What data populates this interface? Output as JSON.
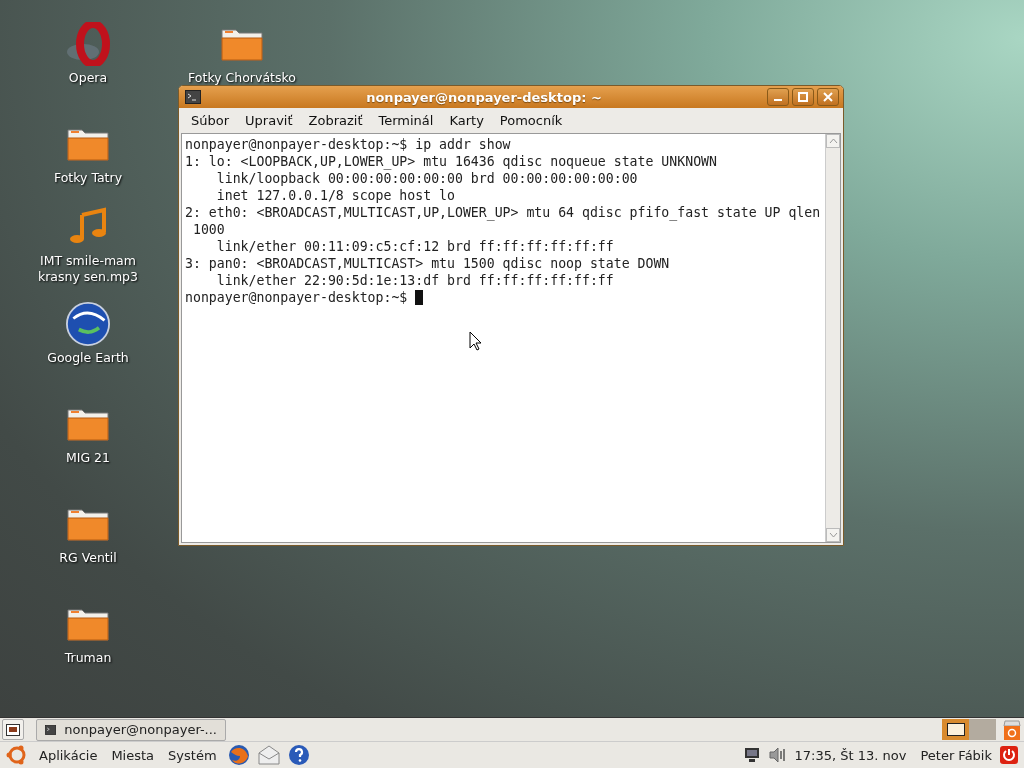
{
  "desktop_icons": [
    {
      "label": "Opera",
      "kind": "opera"
    },
    {
      "label": "Fotky Chorvátsko",
      "kind": "folder"
    },
    {
      "label": "Fotky Tatry",
      "kind": "folder"
    },
    {
      "label": "IMT smile-mam krasny sen.mp3",
      "kind": "music"
    },
    {
      "label": "Google Earth",
      "kind": "earth"
    },
    {
      "label": "MIG 21",
      "kind": "folder"
    },
    {
      "label": "RG Ventil",
      "kind": "folder"
    },
    {
      "label": "Truman",
      "kind": "folder"
    }
  ],
  "window": {
    "title": "nonpayer@nonpayer-desktop: ~",
    "menu": [
      "Súbor",
      "Upraviť",
      "Zobraziť",
      "Terminál",
      "Karty",
      "Pomocník"
    ],
    "lines": [
      "nonpayer@nonpayer-desktop:~$ ip addr show",
      "1: lo: <LOOPBACK,UP,LOWER_UP> mtu 16436 qdisc noqueue state UNKNOWN",
      "    link/loopback 00:00:00:00:00:00 brd 00:00:00:00:00:00",
      "    inet 127.0.0.1/8 scope host lo",
      "2: eth0: <BROADCAST,MULTICAST,UP,LOWER_UP> mtu 64 qdisc pfifo_fast state UP qlen",
      " 1000",
      "    link/ether 00:11:09:c5:cf:12 brd ff:ff:ff:ff:ff:ff",
      "3: pan0: <BROADCAST,MULTICAST> mtu 1500 qdisc noop state DOWN",
      "    link/ether 22:90:5d:1e:13:df brd ff:ff:ff:ff:ff:ff",
      "nonpayer@nonpayer-desktop:~$ "
    ]
  },
  "top_panel": {
    "tasks": [
      {
        "label": "nonpayer@nonpayer-...",
        "selected": false
      }
    ],
    "workspaces": [
      {
        "selected": true
      },
      {
        "selected": false
      }
    ]
  },
  "bottom_panel": {
    "menus": [
      "Aplikácie",
      "Miesta",
      "Systém"
    ],
    "clock": "17:35, Št 13. nov",
    "user": "Peter Fábik"
  }
}
